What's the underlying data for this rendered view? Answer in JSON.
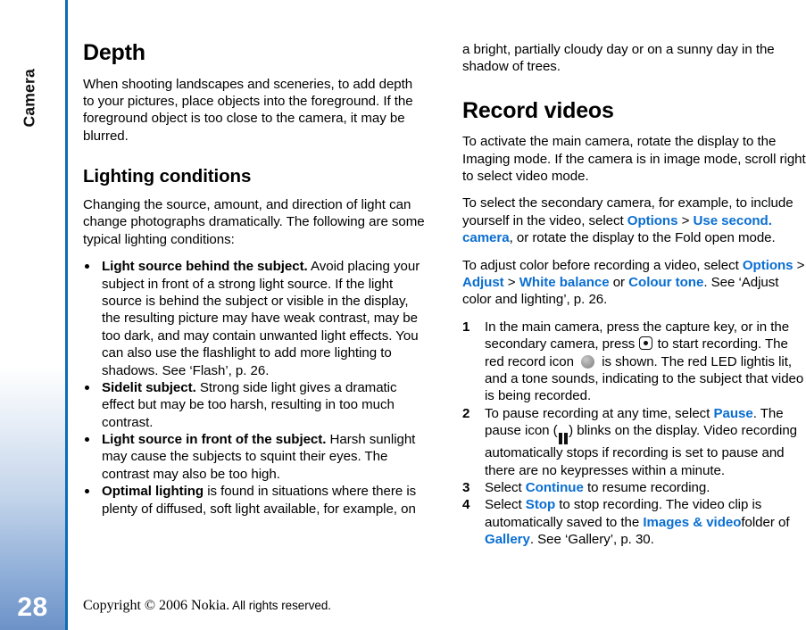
{
  "chapter": {
    "label": "Camera",
    "page_number": "28"
  },
  "footer": {
    "copyright_serif": "Copyright © 2006 Nokia.",
    "copyright_sans": "All rights reserved."
  },
  "left_column": {
    "heading_depth": "Depth",
    "depth_paragraph": "When shooting landscapes and sceneries, to add depth to your pictures, place objects into the foreground. If the foreground object is too close to the camera, it may be blurred.",
    "heading_lighting": "Lighting conditions",
    "lighting_intro": "Changing the source, amount, and direction of light can change photographs dramatically. The following are some typical lighting conditions:",
    "bullets": [
      {
        "lead": "Light source behind the subject.",
        "text": " Avoid placing your subject in front of a strong light source. If the light source is behind the subject or visible in the display, the resulting picture may have weak contrast, may be too dark, and may contain unwanted light effects. You can also use the flashlight to add more lighting to shadows. See ‘Flash’, p. 26."
      },
      {
        "lead": "Sidelit subject.",
        "text": " Strong side light gives a dramatic effect but may be too harsh, resulting in too much contrast."
      },
      {
        "lead": "Light source in front of the subject.",
        "text": " Harsh sunlight may cause the subjects to squint their eyes. The contrast may also be too high."
      },
      {
        "lead": "Optimal lighting",
        "text": " is found in situations where there is plenty of diffused, soft light available, for example, on"
      }
    ]
  },
  "right_column": {
    "continued_paragraph": "a bright, partially cloudy day or on a sunny day in the shadow of trees.",
    "heading_record_videos": "Record videos",
    "activate_paragraph": "To activate the main camera, rotate the display to the Imaging mode. If the camera is in image mode, scroll right to select video mode.",
    "secondary_camera": {
      "part1": "To select the secondary camera, for example, to include yourself in the video, select ",
      "link_options": "Options",
      "separator": " > ",
      "link_use_second_camera": "Use second. camera",
      "part2": ", or rotate the display to the Fold open mode."
    },
    "adjust_color": {
      "part1": "To adjust color before recording a video, select ",
      "link_options": "Options",
      "sep1": " > ",
      "link_adjust": "Adjust",
      "sep2": " > ",
      "link_white_balance": "White balance",
      "or_text": " or ",
      "link_colour_tone": "Colour tone",
      "part2": ". See ‘Adjust color and lighting’, p. 26."
    },
    "steps": [
      {
        "number": "1",
        "part1": "In the main camera, press the capture key, or in the secondary camera, press ",
        "icon1": "scroll-key-icon",
        "part2": " to start recording. The red record icon ",
        "icon2": "record-circle-icon",
        "part3": " is shown. The red LED lightis lit, and a tone sounds, indicating to the subject that video is being recorded."
      },
      {
        "number": "2",
        "part1": "To pause recording at any time, select ",
        "link": "Pause",
        "part2": ". The pause icon (",
        "icon": "pause-bars-icon",
        "part3": ") blinks on the display. Video recording automatically stops if recording is set to pause and there are no keypresses within a minute."
      },
      {
        "number": "3",
        "part1": "Select ",
        "link": "Continue",
        "part2": " to resume recording."
      },
      {
        "number": "4",
        "part1": "Select ",
        "link_stop": "Stop",
        "part2": " to stop recording. The video clip is automatically saved to the ",
        "link_images_video": "Images & video",
        "part3": "folder of ",
        "link_gallery": "Gallery",
        "part4": ". See ‘Gallery’, p. 30."
      }
    ]
  },
  "colors": {
    "link_blue": "#0a6ed1",
    "rail_divider_blue": "#0d6cb5",
    "rail_gradient_bottom": "#6c92c8"
  }
}
